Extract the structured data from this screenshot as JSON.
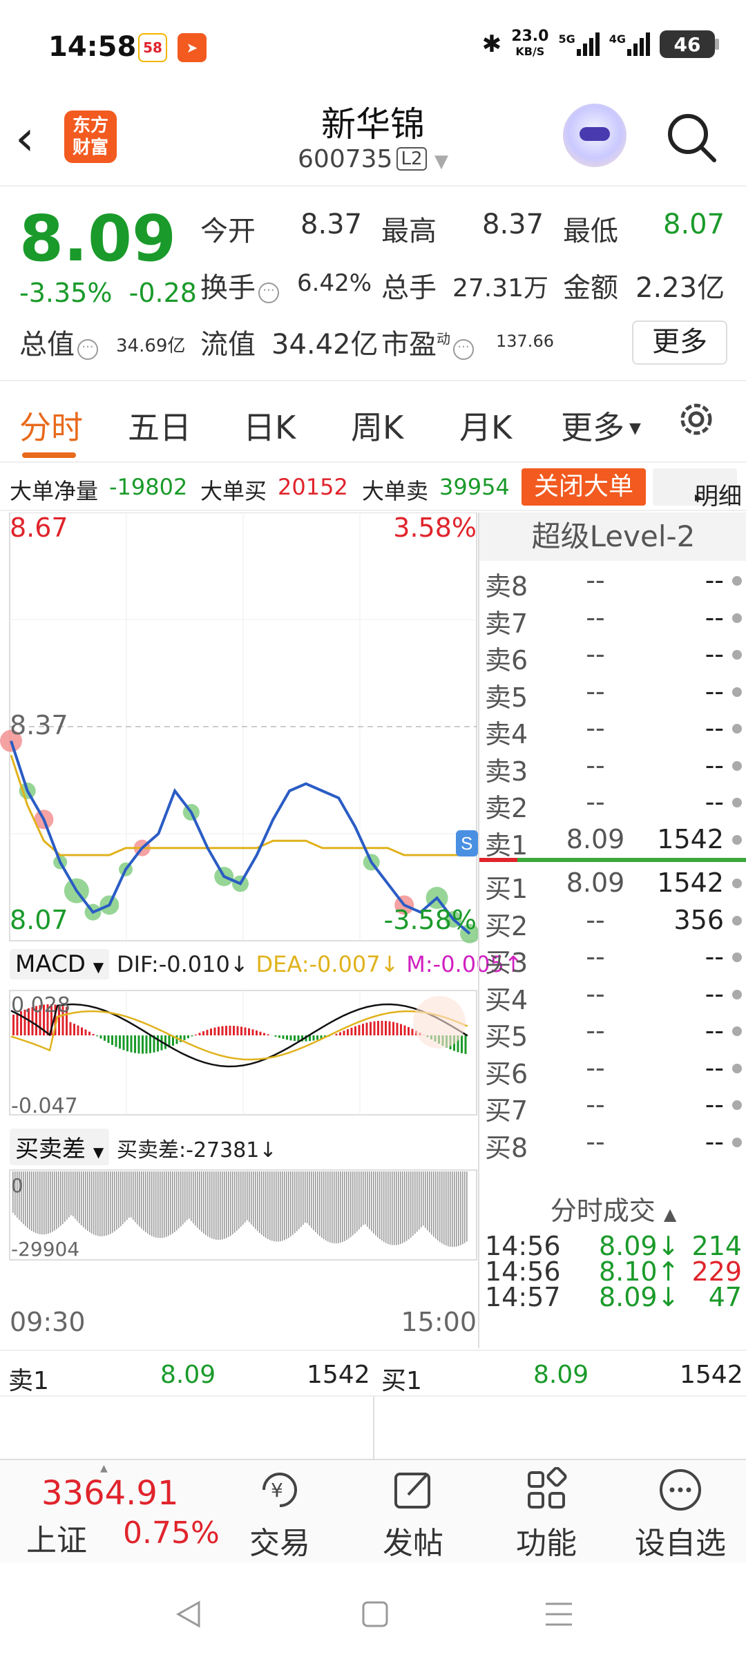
{
  "status_bar": {
    "time": "14:58",
    "app_badge_1": "58",
    "net_speed": "23.0",
    "net_unit": "KB/S",
    "sig1": "5G",
    "sig2": "4G",
    "battery": "46"
  },
  "header": {
    "brand_line1": "东方",
    "brand_line2": "财富",
    "stock_name": "新华锦",
    "stock_code": "600735",
    "level_badge": "L2"
  },
  "quote": {
    "price": "8.09",
    "change_pct": "-3.35%",
    "change_abs": "-0.28",
    "open_label": "今开",
    "open": "8.37",
    "high_label": "最高",
    "high": "8.37",
    "low_label": "最低",
    "low": "8.07",
    "turnover_label": "换手",
    "turnover": "6.42%",
    "volume_label": "总手",
    "volume": "27.31万",
    "amount_label": "金额",
    "amount": "2.23亿",
    "mktcap_label": "总值",
    "mktcap": "34.69亿",
    "float_label": "流值",
    "float_cap": "34.42亿",
    "pe_label": "市盈",
    "pe_sup": "动",
    "pe": "137.66",
    "more": "更多"
  },
  "tabs": {
    "t1": "分时",
    "t2": "五日",
    "t3": "日K",
    "t4": "周K",
    "t5": "月K",
    "t6": "更多"
  },
  "big_orders": {
    "net_label": "大单净量",
    "net": "-19802",
    "buy_label": "大单买",
    "buy": "20152",
    "sell_label": "大单卖",
    "sell": "39954",
    "close_btn": "关闭大单",
    "detail_btn": "明细"
  },
  "chart_labels": {
    "high_price": "8.67",
    "high_pct": "3.58%",
    "ref_price": "8.37",
    "low_price": "8.07",
    "low_pct": "-3.58%",
    "macd_name": "MACD",
    "dif": "DIF:-0.010↓",
    "dea": "DEA:-0.007↓",
    "m": "M:-0.005↑",
    "macd_top": "0.028",
    "macd_bottom": "-0.047",
    "diff_name": "买卖差",
    "diff_value": "买卖差:-27381↓",
    "diff_top": "0",
    "diff_bottom": "-29904",
    "time_start": "09:30",
    "time_end": "15:00"
  },
  "chart_data": {
    "type": "line",
    "ylim": [
      8.07,
      8.67
    ],
    "reference": 8.37,
    "x_range": [
      "09:30",
      "15:00"
    ],
    "series": [
      {
        "values": [
          8.35,
          8.28,
          8.24,
          8.18,
          8.14,
          8.11,
          8.12,
          8.17,
          8.2,
          8.22,
          8.28,
          8.25,
          8.2,
          8.16,
          8.15,
          8.19,
          8.24,
          8.28,
          8.29,
          8.28,
          8.27,
          8.23,
          8.18,
          8.15,
          8.12,
          8.11,
          8.13,
          8.1,
          8.08
        ]
      },
      {
        "values": [
          8.33,
          8.26,
          8.21,
          8.19,
          8.19,
          8.19,
          8.19,
          8.2,
          8.2,
          8.2,
          8.2,
          8.2,
          8.2,
          8.2,
          8.2,
          8.2,
          8.21,
          8.21,
          8.21,
          8.2,
          8.2,
          8.2,
          8.2,
          8.2,
          8.19,
          8.19,
          8.19,
          8.19,
          8.19
        ]
      }
    ]
  },
  "level2": {
    "title": "超级Level-2",
    "asks": [
      {
        "label": "卖8",
        "price": "--",
        "vol": "--"
      },
      {
        "label": "卖7",
        "price": "--",
        "vol": "--"
      },
      {
        "label": "卖6",
        "price": "--",
        "vol": "--"
      },
      {
        "label": "卖5",
        "price": "--",
        "vol": "--"
      },
      {
        "label": "卖4",
        "price": "--",
        "vol": "--"
      },
      {
        "label": "卖3",
        "price": "--",
        "vol": "--"
      },
      {
        "label": "卖2",
        "price": "--",
        "vol": "--"
      },
      {
        "label": "卖1",
        "price": "8.09",
        "vol": "1542"
      }
    ],
    "bids": [
      {
        "label": "买1",
        "price": "8.09",
        "vol": "1542"
      },
      {
        "label": "买2",
        "price": "--",
        "vol": "356"
      },
      {
        "label": "买3",
        "price": "--",
        "vol": "--"
      },
      {
        "label": "买4",
        "price": "--",
        "vol": "--"
      },
      {
        "label": "买5",
        "price": "--",
        "vol": "--"
      },
      {
        "label": "买6",
        "price": "--",
        "vol": "--"
      },
      {
        "label": "买7",
        "price": "--",
        "vol": "--"
      },
      {
        "label": "买8",
        "price": "--",
        "vol": "--"
      }
    ],
    "trades_title": "分时成交",
    "trades": [
      {
        "time": "14:56",
        "price": "8.09↓",
        "vol": "214"
      },
      {
        "time": "14:56",
        "price": "8.10↑",
        "vol": "229"
      },
      {
        "time": "14:57",
        "price": "8.09↓",
        "vol": "47"
      }
    ]
  },
  "quote_bar": {
    "sell_label": "卖1",
    "sell_price": "8.09",
    "sell_vol": "1542",
    "buy_label": "买1",
    "buy_price": "8.09",
    "buy_vol": "1542"
  },
  "bottom_nav": {
    "index_value": "3364.91",
    "index_name": "上证",
    "index_pct": "0.75%",
    "trade": "交易",
    "post": "发帖",
    "function": "功能",
    "watchlist": "设自选"
  },
  "colors": {
    "up": "#e0242c",
    "down": "#1a9a2a",
    "accent": "#f25a1f",
    "price_line": "#2a5cc4",
    "avg_line": "#e0b21c"
  }
}
